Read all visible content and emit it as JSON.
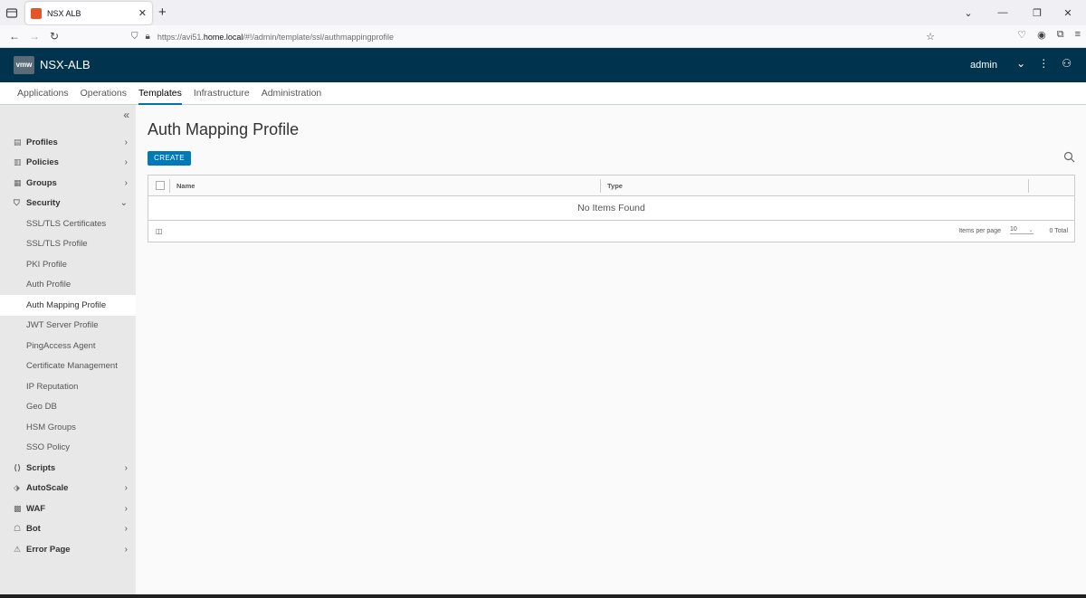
{
  "browser": {
    "tab_title": "NSX ALB",
    "url_prefix": "https://avi51.",
    "url_host": "home.local",
    "url_path": "/#!/admin/template/ssl/authmappingprofile"
  },
  "app": {
    "title": "NSX-ALB",
    "logo_text": "vmw",
    "user": "admin"
  },
  "tabs": [
    {
      "label": "Applications"
    },
    {
      "label": "Operations"
    },
    {
      "label": "Templates"
    },
    {
      "label": "Infrastructure"
    },
    {
      "label": "Administration"
    }
  ],
  "sidebar": {
    "groups_top": [
      {
        "label": "Profiles",
        "icon": "profile-icon"
      },
      {
        "label": "Policies",
        "icon": "policy-icon"
      },
      {
        "label": "Groups",
        "icon": "groups-icon"
      },
      {
        "label": "Security",
        "icon": "shield-icon"
      }
    ],
    "security_items": [
      {
        "label": "SSL/TLS Certificates"
      },
      {
        "label": "SSL/TLS Profile"
      },
      {
        "label": "PKI Profile"
      },
      {
        "label": "Auth Profile"
      },
      {
        "label": "Auth Mapping Profile"
      },
      {
        "label": "JWT Server Profile"
      },
      {
        "label": "PingAccess Agent"
      },
      {
        "label": "Certificate Management"
      },
      {
        "label": "IP Reputation"
      },
      {
        "label": "Geo DB"
      },
      {
        "label": "HSM Groups"
      },
      {
        "label": "SSO Policy"
      }
    ],
    "groups_bottom": [
      {
        "label": "Scripts",
        "icon": "scripts-icon"
      },
      {
        "label": "AutoScale",
        "icon": "autoscale-icon"
      },
      {
        "label": "WAF",
        "icon": "waf-icon"
      },
      {
        "label": "Bot",
        "icon": "bot-icon"
      },
      {
        "label": "Error Page",
        "icon": "warning-icon"
      }
    ]
  },
  "main": {
    "title": "Auth Mapping Profile",
    "create_label": "CREATE",
    "columns": {
      "name": "Name",
      "type": "Type"
    },
    "empty_text": "No Items Found",
    "footer": {
      "items_per_page_label": "Items per page",
      "items_per_page_value": "10",
      "total": "0 Total"
    }
  }
}
